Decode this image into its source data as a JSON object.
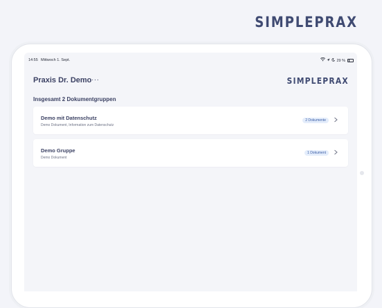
{
  "brand": {
    "name": "SIMPLEPRAX"
  },
  "status_bar": {
    "time": "14:55",
    "date": "Mittwoch 1. Sept.",
    "battery": "29 %",
    "battery_level": 0.29
  },
  "header": {
    "title": "Praxis Dr. Demo",
    "more": "···",
    "logo": "SIMPLEPRAX"
  },
  "summary": "Insgesamt 2 Dokumentgruppen",
  "groups": [
    {
      "title": "Demo mit Datenschutz",
      "subtitle": "Demo Dokument, Information zum Datenschutz",
      "badge": "2 Dokumente"
    },
    {
      "title": "Demo Gruppe",
      "subtitle": "Demo Dokument",
      "badge": "1 Dokument"
    }
  ],
  "colors": {
    "brand": "#3f4a72",
    "badge_bg": "#e4edfb",
    "badge_text": "#3c5fa6",
    "background": "#f3f4f9"
  }
}
